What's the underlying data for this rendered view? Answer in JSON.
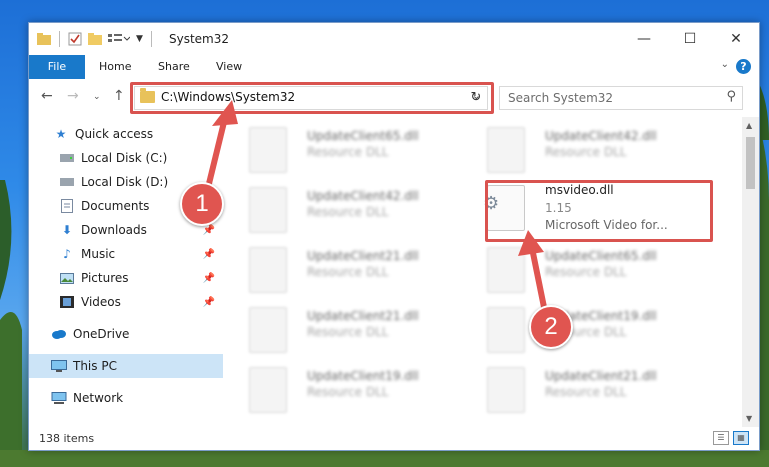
{
  "window": {
    "title": "System32",
    "min_glyph": "—",
    "max_glyph": "☐",
    "close_glyph": "✕"
  },
  "ribbon": {
    "tabs": [
      "File",
      "Home",
      "Share",
      "View"
    ],
    "help": "?"
  },
  "navigation": {
    "address_path": "C:\\Windows\\System32",
    "search_placeholder": "Search System32"
  },
  "sidebar": {
    "items": [
      {
        "label": "Quick access",
        "icon": "star-icon",
        "pinned": false
      },
      {
        "label": "Local Disk (C:)",
        "icon": "drive-icon",
        "pinned": false
      },
      {
        "label": "Local Disk (D:)",
        "icon": "drive-icon",
        "pinned": false
      },
      {
        "label": "Documents",
        "icon": "document-icon",
        "pinned": true
      },
      {
        "label": "Downloads",
        "icon": "download-icon",
        "pinned": true
      },
      {
        "label": "Music",
        "icon": "music-icon",
        "pinned": true
      },
      {
        "label": "Pictures",
        "icon": "picture-icon",
        "pinned": true
      },
      {
        "label": "Videos",
        "icon": "video-icon",
        "pinned": true
      },
      {
        "label": "OneDrive",
        "icon": "cloud-icon",
        "pinned": false
      },
      {
        "label": "This PC",
        "icon": "computer-icon",
        "pinned": false,
        "selected": true
      },
      {
        "label": "Network",
        "icon": "network-icon",
        "pinned": false
      }
    ]
  },
  "files": [
    {
      "name": "UpdateClient65.dll",
      "type": "Resource DLL"
    },
    {
      "name": "UpdateClient42.dll",
      "type": "Resource DLL"
    },
    {
      "name": "UpdateClient42.dll",
      "type": "Resource DLL"
    },
    {
      "name": "msvideo.dll",
      "type": "1.15",
      "description": "Microsoft Video for...",
      "highlighted": true
    },
    {
      "name": "UpdateClient21.dll",
      "type": "Resource DLL"
    },
    {
      "name": "UpdateClient65.dll",
      "type": "Resource DLL"
    },
    {
      "name": "UpdateClient21.dll",
      "type": "Resource DLL"
    },
    {
      "name": "UpdateClient19.dll",
      "type": "Resource DLL"
    },
    {
      "name": "UpdateClient19.dll",
      "type": "Resource DLL"
    },
    {
      "name": "UpdateClient21.dll",
      "type": "Resource DLL"
    }
  ],
  "status": {
    "item_count": "138 items"
  },
  "annotations": {
    "step1": "1",
    "step2": "2"
  },
  "colors": {
    "accent": "#1979ca",
    "highlight": "#d9534f",
    "selection": "#cce4f7"
  }
}
